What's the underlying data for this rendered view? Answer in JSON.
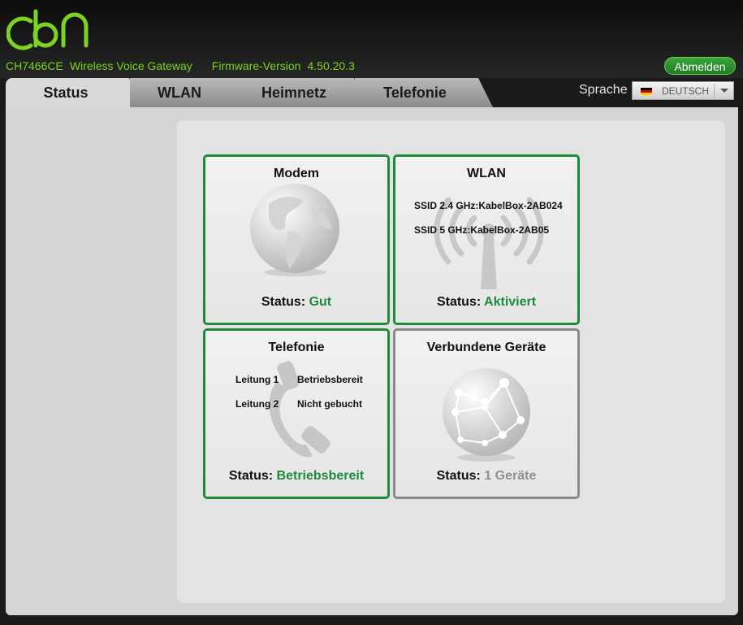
{
  "brand": {
    "logo_text": "cbn",
    "accent": "#7dd321"
  },
  "device": {
    "model": "CH7466CE",
    "description": "Wireless Voice Gateway",
    "firmware_label": "Firmware-Version",
    "firmware_version": "4.50.20.3"
  },
  "header": {
    "logout_label": "Abmelden"
  },
  "tabs": [
    {
      "label": "Status",
      "active": true
    },
    {
      "label": "WLAN",
      "active": false
    },
    {
      "label": "Heimnetz",
      "active": false
    },
    {
      "label": "Telefonie",
      "active": false
    }
  ],
  "language": {
    "label": "Sprache",
    "selected": "DEUTSCH",
    "flag": "de-flag-icon"
  },
  "cards": {
    "modem": {
      "title": "Modem",
      "icon": "globe-icon",
      "status_label": "Status:",
      "status_value": "Gut"
    },
    "wlan": {
      "title": "WLAN",
      "icon": "antenna-icon",
      "ssid24": "SSID 2.4 GHz:KabelBox-2AB024",
      "ssid5": "SSID 5 GHz:KabelBox-2AB05",
      "status_label": "Status:",
      "status_value": "Aktiviert"
    },
    "telephony": {
      "title": "Telefonie",
      "icon": "phone-handset-icon",
      "lines": [
        {
          "name": "Leitung 1",
          "state": "Betriebsbereit"
        },
        {
          "name": "Leitung 2",
          "state": "Nicht gebucht"
        }
      ],
      "status_label": "Status:",
      "status_value": "Betriebsbereit"
    },
    "devices": {
      "title": "Verbundene Geräte",
      "icon": "network-globe-icon",
      "status_label": "Status:",
      "status_value": "1 Geräte"
    }
  },
  "colors": {
    "status_ok": "#1e8a3c",
    "status_neutral": "#909090",
    "card_border_active": "#1e8a3c",
    "card_border_inactive": "#8a8a8a"
  }
}
